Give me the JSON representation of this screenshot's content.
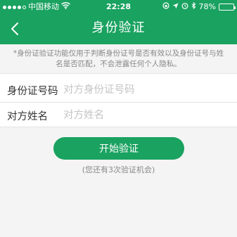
{
  "status_bar": {
    "carrier": "中国移动",
    "time": "22:28",
    "battery": "78%",
    "battery_level": 0.78,
    "signal_bars": 4,
    "icons": [
      "signal-dots-icon",
      "wifi-icon",
      "lock-rotation-icon",
      "location-arrow-icon",
      "alarm-icon",
      "bluetooth-icon",
      "battery-icon"
    ]
  },
  "nav": {
    "title": "身份验证",
    "back_icon": "chevron-left-icon"
  },
  "notice": "*身份证验证功能仅用于判断身份证号是否有效以及身份证号与姓名是否匹配，不会泄露任何个人隐私。",
  "form": {
    "id_label": "身份证号码",
    "id_placeholder": "对方身份证号码",
    "id_value": "",
    "name_label": "对方姓名",
    "name_placeholder": "对方姓名",
    "name_value": ""
  },
  "submit_label": "开始验证",
  "remaining_hint": "(您还有3次验证机会)",
  "colors": {
    "brand_green": "#1aa260",
    "background": "#f4f4f4",
    "hint_text": "#888888",
    "placeholder": "#c4c4c4"
  }
}
